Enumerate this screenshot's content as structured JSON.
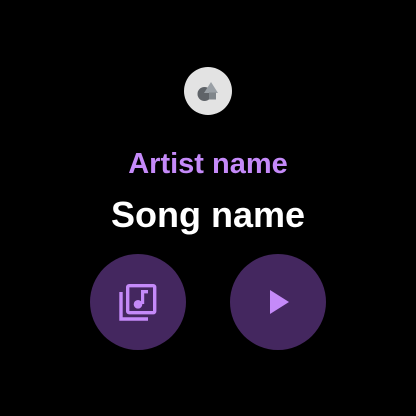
{
  "header": {
    "app_icon": "shapes-icon"
  },
  "track": {
    "artist": "Artist name",
    "song": "Song name"
  },
  "controls": {
    "library_icon": "music-library-icon",
    "play_icon": "play-icon"
  },
  "colors": {
    "background": "#000000",
    "accent": "#c58af9",
    "title": "#ffffff",
    "button_bg": "#44275f",
    "app_icon_bg": "#e3e3e3",
    "app_icon_fg": "#5f6368"
  }
}
